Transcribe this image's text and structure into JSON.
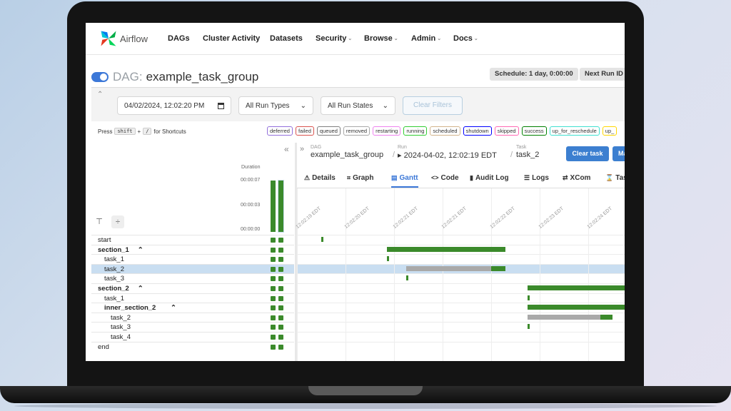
{
  "app": {
    "name": "Airflow"
  },
  "nav": {
    "items": [
      {
        "label": "DAGs",
        "caret": false
      },
      {
        "label": "Cluster Activity",
        "caret": false
      },
      {
        "label": "Datasets",
        "caret": false
      },
      {
        "label": "Security",
        "caret": true
      },
      {
        "label": "Browse",
        "caret": true
      },
      {
        "label": "Admin",
        "caret": true
      },
      {
        "label": "Docs",
        "caret": true
      }
    ]
  },
  "header": {
    "dag_label": "DAG:",
    "dag_name": "example_task_group",
    "schedule": "Schedule: 1 day, 0:00:00",
    "next_run": "Next Run ID"
  },
  "filters": {
    "date": "04/02/2024, 12:02:20 PM",
    "run_types": "All Run Types",
    "run_states": "All Run States",
    "clear": "Clear Filters"
  },
  "shortcuts": {
    "press": "Press",
    "key1": "shift",
    "plus": "+",
    "key2": "/",
    "for": "for Shortcuts"
  },
  "legend": [
    {
      "label": "deferred",
      "color": "#9370db"
    },
    {
      "label": "failed",
      "color": "#d9534f"
    },
    {
      "label": "queued",
      "color": "#808080"
    },
    {
      "label": "removed",
      "color": "#a9a9a9"
    },
    {
      "label": "restarting",
      "color": "#ee82ee"
    },
    {
      "label": "running",
      "color": "#32cd32"
    },
    {
      "label": "scheduled",
      "color": "#d2b48c"
    },
    {
      "label": "shutdown",
      "color": "#0000ff"
    },
    {
      "label": "skipped",
      "color": "#ff69b4"
    },
    {
      "label": "success",
      "color": "#008000"
    },
    {
      "label": "up_for_reschedule",
      "color": "#40e0d0"
    },
    {
      "label": "up_",
      "color": "#ffd700"
    }
  ],
  "grid": {
    "duration_label": "Duration",
    "ticks": [
      "00:00:07",
      "00:00:03",
      "00:00:00"
    ],
    "collapse_all_icon": "collapse-all-icon",
    "expand_all_icon": "expand-all-icon"
  },
  "tasks": [
    {
      "name": "start",
      "indent": 0,
      "bold": false,
      "selected": false
    },
    {
      "name": "section_1",
      "indent": 0,
      "bold": true,
      "selected": false,
      "group": true
    },
    {
      "name": "task_1",
      "indent": 1,
      "bold": false,
      "selected": false
    },
    {
      "name": "task_2",
      "indent": 1,
      "bold": false,
      "selected": true
    },
    {
      "name": "task_3",
      "indent": 1,
      "bold": false,
      "selected": false
    },
    {
      "name": "section_2",
      "indent": 0,
      "bold": true,
      "selected": false,
      "group": true
    },
    {
      "name": "task_1",
      "indent": 1,
      "bold": false,
      "selected": false
    },
    {
      "name": "inner_section_2",
      "indent": 1,
      "bold": true,
      "selected": false,
      "group": true
    },
    {
      "name": "task_2",
      "indent": 2,
      "bold": false,
      "selected": false
    },
    {
      "name": "task_3",
      "indent": 2,
      "bold": false,
      "selected": false
    },
    {
      "name": "task_4",
      "indent": 2,
      "bold": false,
      "selected": false
    },
    {
      "name": "end",
      "indent": 0,
      "bold": false,
      "selected": false
    }
  ],
  "breadcrumb": {
    "dag_small": "DAG",
    "dag": "example_task_group",
    "run_small": "Run",
    "run": "▸ 2024-04-02, 12:02:19 EDT",
    "task_small": "Task",
    "task": "task_2",
    "sep": "/"
  },
  "actions": {
    "clear_task": "Clear task",
    "mark": "Ma"
  },
  "tabs": [
    {
      "label": "Details",
      "icon": "info-icon",
      "glyph": "⚠",
      "active": false
    },
    {
      "label": "Graph",
      "icon": "graph-icon",
      "glyph": "⌗",
      "active": false
    },
    {
      "label": "Gantt",
      "icon": "gantt-icon",
      "glyph": "▤",
      "active": true
    },
    {
      "label": "Code",
      "icon": "code-icon",
      "glyph": "<>",
      "active": false
    },
    {
      "label": "Audit Log",
      "icon": "audit-log-icon",
      "glyph": "▮",
      "active": false
    },
    {
      "label": "Logs",
      "icon": "logs-icon",
      "glyph": "☰",
      "active": false
    },
    {
      "label": "XCom",
      "icon": "xcom-icon",
      "glyph": "⇄",
      "active": false
    },
    {
      "label": "Tas",
      "icon": "task-icon",
      "glyph": "⌛",
      "active": false
    }
  ],
  "gantt": {
    "time_labels": [
      "12:02:19 EDT",
      "12:02:20 EDT",
      "12:02:21 EDT",
      "12:02:21 EDT",
      "12:02:22 EDT",
      "12:02:23 EDT",
      "12:02:24 EDT"
    ],
    "bars": [
      {
        "row": 0,
        "segments": [
          {
            "start": 0.5,
            "end": 0.53,
            "state": "success"
          }
        ]
      },
      {
        "row": 1,
        "segments": [
          {
            "start": 1.85,
            "end": 4.3,
            "state": "success"
          }
        ]
      },
      {
        "row": 2,
        "segments": [
          {
            "start": 1.85,
            "end": 1.9,
            "state": "success"
          }
        ]
      },
      {
        "row": 3,
        "segments": [
          {
            "start": 2.25,
            "end": 4.0,
            "state": "queued"
          },
          {
            "start": 4.0,
            "end": 4.3,
            "state": "success"
          }
        ]
      },
      {
        "row": 4,
        "segments": [
          {
            "start": 2.25,
            "end": 2.3,
            "state": "success"
          }
        ]
      },
      {
        "row": 5,
        "segments": [
          {
            "start": 4.75,
            "end": 6.9,
            "state": "success"
          }
        ]
      },
      {
        "row": 6,
        "segments": [
          {
            "start": 4.75,
            "end": 4.8,
            "state": "success"
          }
        ]
      },
      {
        "row": 7,
        "segments": [
          {
            "start": 4.75,
            "end": 6.9,
            "state": "success"
          }
        ]
      },
      {
        "row": 8,
        "segments": [
          {
            "start": 4.75,
            "end": 6.25,
            "state": "queued"
          },
          {
            "start": 6.25,
            "end": 6.5,
            "state": "success"
          }
        ]
      },
      {
        "row": 9,
        "segments": [
          {
            "start": 4.75,
            "end": 4.8,
            "state": "success"
          }
        ]
      }
    ]
  },
  "colors": {
    "accent": "#3c78d8",
    "success": "#3b8a2b",
    "queued": "#a9a9a9",
    "selected_row": "#c9def1"
  }
}
